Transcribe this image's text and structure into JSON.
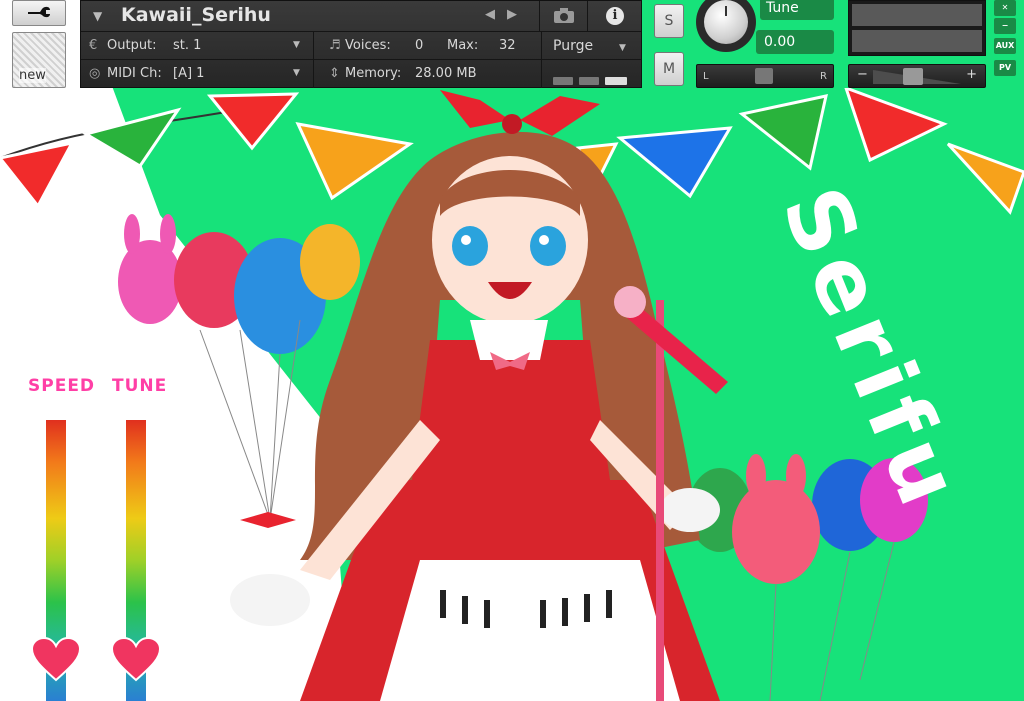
{
  "header": {
    "instrument_name": "Kawaii_Serihu",
    "output_label": "Output:",
    "output_value": "st. 1",
    "voices_label": "Voices:",
    "voices_value": "0",
    "max_label": "Max:",
    "max_value": "32",
    "purge_label": "Purge",
    "midi_label": "MIDI Ch:",
    "midi_value": "[A]  1",
    "memory_label": "Memory:",
    "memory_value": "28.00 MB"
  },
  "tools": {
    "new_label": "new"
  },
  "strip": {
    "solo_label": "S",
    "mute_label": "M",
    "tune_label": "Tune",
    "tune_value": "0.00",
    "pan_left": "L",
    "pan_right": "R",
    "vol_minus": "−",
    "vol_plus": "+",
    "side_buttons": [
      "✕",
      "−",
      "AUX",
      "PV"
    ]
  },
  "artwork": {
    "title_text": "Serifu",
    "speed_label": "SPEED",
    "tune_meter_label": "TUNE"
  },
  "colors": {
    "green_bg": "#17e27a",
    "label_pink": "#ff3fa6",
    "knob_accent": "#1a8a46"
  },
  "icons": {
    "wrench": "wrench-icon",
    "camera": "camera-icon",
    "info": "info-icon",
    "heart": "heart-icon"
  }
}
